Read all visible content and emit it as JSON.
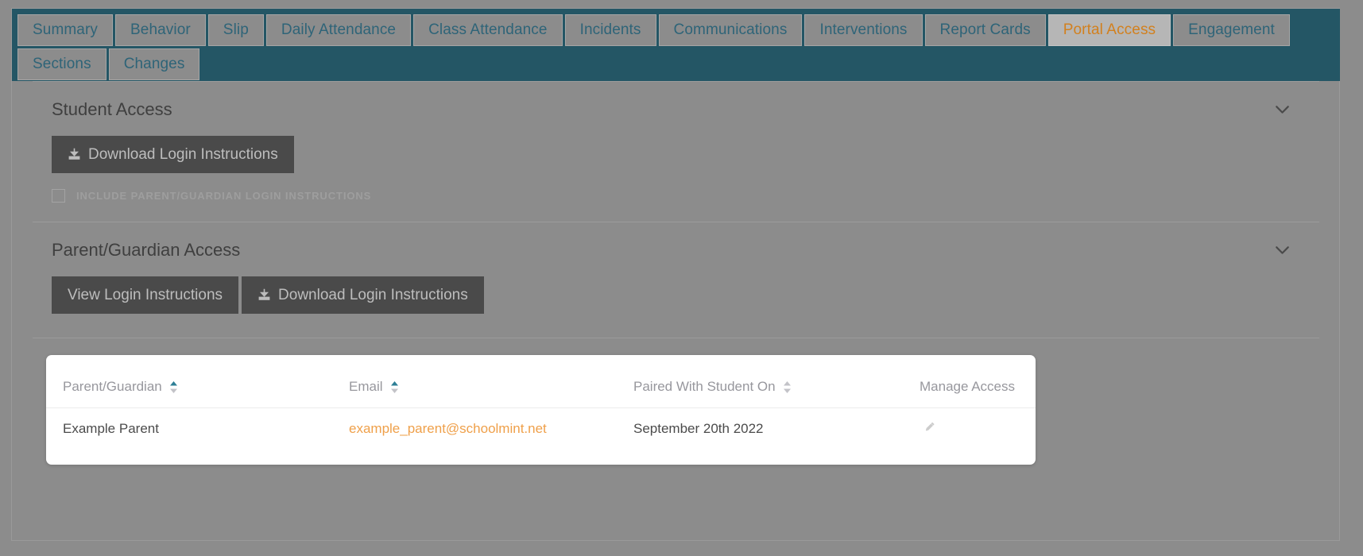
{
  "tabs": [
    {
      "label": "Summary",
      "active": false
    },
    {
      "label": "Behavior",
      "active": false
    },
    {
      "label": "Slip",
      "active": false
    },
    {
      "label": "Daily Attendance",
      "active": false
    },
    {
      "label": "Class Attendance",
      "active": false
    },
    {
      "label": "Incidents",
      "active": false
    },
    {
      "label": "Communications",
      "active": false
    },
    {
      "label": "Interventions",
      "active": false
    },
    {
      "label": "Report Cards",
      "active": false
    },
    {
      "label": "Portal Access",
      "active": true
    },
    {
      "label": "Engagement",
      "active": false
    },
    {
      "label": "Sections",
      "active": false
    },
    {
      "label": "Changes",
      "active": false
    }
  ],
  "student_access": {
    "title": "Student Access",
    "download_button": "Download Login Instructions",
    "download_icon": "download-icon",
    "collapse_icon": "chevron-down-icon",
    "checkbox_label": "Include Parent/Guardian Login Instructions",
    "checkbox_checked": false
  },
  "parent_access": {
    "title": "Parent/Guardian Access",
    "view_button": "View Login Instructions",
    "download_button": "Download Login Instructions",
    "download_icon": "download-icon",
    "collapse_icon": "chevron-down-icon"
  },
  "table": {
    "headers": [
      {
        "label": "Parent/Guardian",
        "sortable": true,
        "sort_state": "asc"
      },
      {
        "label": "Email",
        "sortable": true,
        "sort_state": "asc"
      },
      {
        "label": "Paired With Student On",
        "sortable": true,
        "sort_state": "none"
      },
      {
        "label": "Manage Access",
        "sortable": false,
        "sort_state": "none"
      }
    ],
    "rows": [
      {
        "name": "Example Parent",
        "email": "example_parent@schoolmint.net",
        "paired_on": "September 20th 2022",
        "manage_icon": "pencil-icon"
      }
    ]
  },
  "colors": {
    "tabbar_bg": "#245665",
    "tab_text": "#2e6478",
    "tab_active_text": "#d2801e",
    "page_bg": "#8c8c8c",
    "button_bg": "#4a4a4a",
    "link_orange": "#efa04a",
    "sort_active": "#2e7f96"
  }
}
